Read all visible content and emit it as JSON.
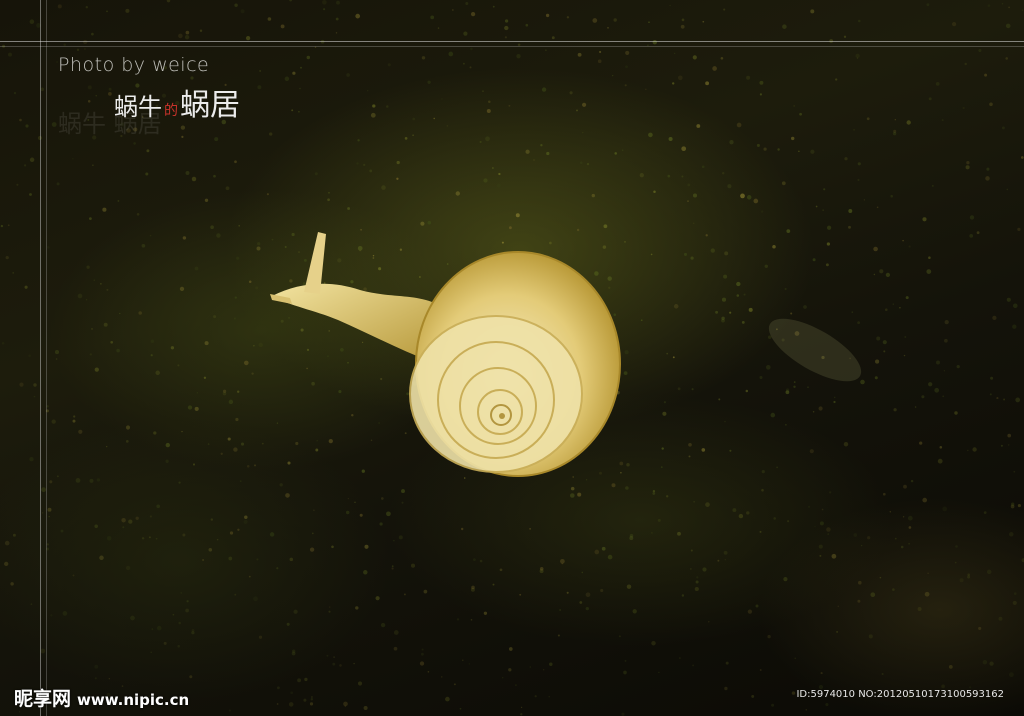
{
  "credit": "Photo by weice",
  "title": {
    "part1": "蜗牛",
    "part2": "的",
    "part3": "蜗居",
    "reflection": "蜗牛 蜗居"
  },
  "watermark": {
    "site_name": "昵享网",
    "url": "www.nipic.cn"
  },
  "image_id": "ID:5974010 NO:20120510173100593162",
  "colors": {
    "background": "#1b1a0c",
    "moss": "#5f641c",
    "shell": "#e8d58a",
    "title_accent": "#c8332a",
    "text": "#ececec"
  }
}
